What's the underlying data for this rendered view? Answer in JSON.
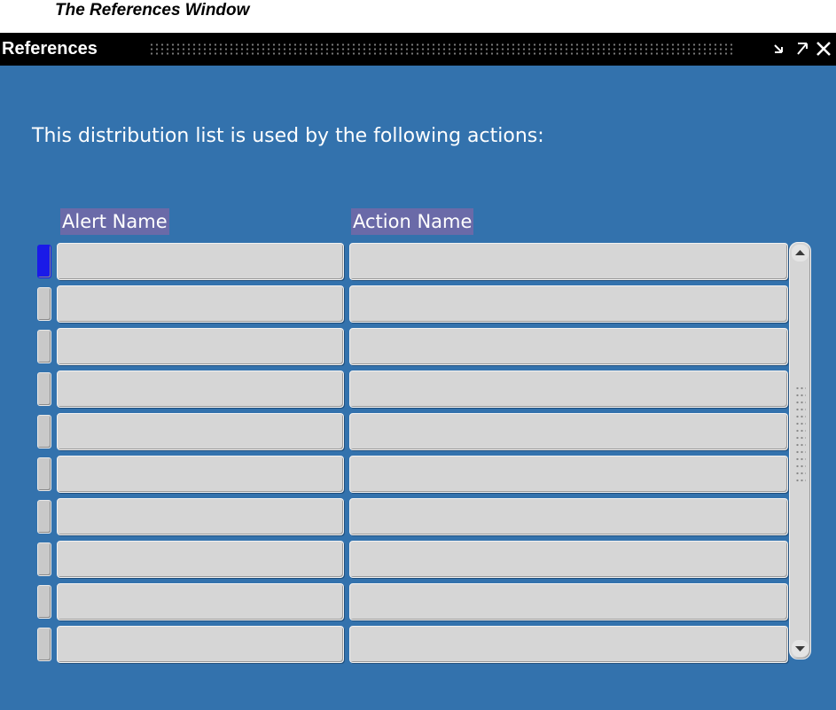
{
  "caption": "The References Window",
  "window": {
    "title": "References",
    "buttons": {
      "minimize_glyph": "⊻",
      "maximize_glyph": "⊼",
      "close_glyph": "✕"
    }
  },
  "prompt": "This distribution list is used by the following actions:",
  "table": {
    "columns": [
      "Alert Name",
      "Action Name"
    ],
    "rows": [
      {
        "alert_name": "",
        "action_name": ""
      },
      {
        "alert_name": "",
        "action_name": ""
      },
      {
        "alert_name": "",
        "action_name": ""
      },
      {
        "alert_name": "",
        "action_name": ""
      },
      {
        "alert_name": "",
        "action_name": ""
      },
      {
        "alert_name": "",
        "action_name": ""
      },
      {
        "alert_name": "",
        "action_name": ""
      },
      {
        "alert_name": "",
        "action_name": ""
      },
      {
        "alert_name": "",
        "action_name": ""
      },
      {
        "alert_name": "",
        "action_name": ""
      }
    ]
  },
  "scrollbar": {
    "up_icon": "up-arrow-icon",
    "down_icon": "down-arrow-icon"
  },
  "colors": {
    "window_bg": "#3372ad",
    "titlebar_bg": "#000000",
    "cell_bg": "#d6d6d6",
    "header_highlight": "#6a6aa8",
    "current_record": "#1a1ae8"
  }
}
